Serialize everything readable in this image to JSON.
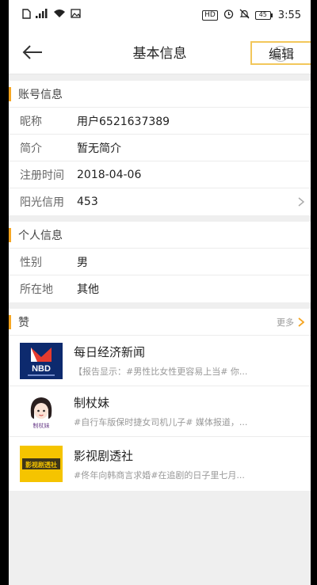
{
  "status_bar": {
    "hd": "HD",
    "battery": "45",
    "time": "3:55"
  },
  "nav": {
    "title": "基本信息",
    "edit_label": "编辑"
  },
  "account": {
    "header": "账号信息",
    "rows": [
      {
        "label": "昵称",
        "value": "用户6521637389"
      },
      {
        "label": "简介",
        "value": "暂无简介"
      },
      {
        "label": "注册时间",
        "value": "2018-04-06"
      },
      {
        "label": "阳光信用",
        "value": "453"
      }
    ]
  },
  "personal": {
    "header": "个人信息",
    "rows": [
      {
        "label": "性别",
        "value": "男"
      },
      {
        "label": "所在地",
        "value": "其他"
      }
    ]
  },
  "likes": {
    "header": "赞",
    "more_label": "更多",
    "items": [
      {
        "title": "每日经济新闻",
        "desc": "【报告显示：#男性比女性更容易上当# 你...",
        "thumb_text": "NBD",
        "thumb_color": "#0d2a6e"
      },
      {
        "title": "制杖妹",
        "desc": "#自行车版保时捷女司机儿子# 媒体报道，...",
        "thumb_text": "制杖妹"
      },
      {
        "title": "影视剧透社",
        "desc": "#佟年向韩商言求婚#在追剧的日子里七月...",
        "thumb_text": "影视剧透社",
        "thumb_color": "#f5c400"
      }
    ]
  },
  "colors": {
    "accent": "#f5a623",
    "edit_highlight": "#f2c75b"
  }
}
